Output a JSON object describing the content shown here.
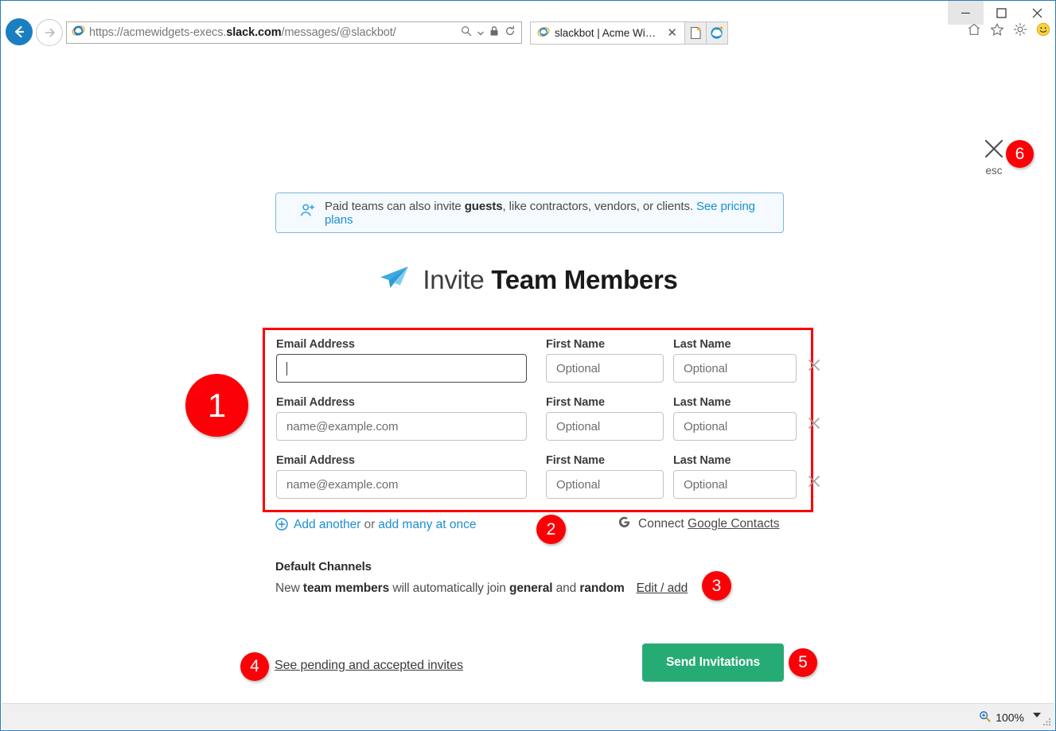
{
  "browser": {
    "back_icon": "back-arrow-icon",
    "forward_icon": "forward-arrow-icon",
    "address_url_prefix": "https://acmewidgets-execs.",
    "address_url_domain": "slack.com",
    "address_url_suffix": "/messages/@slackbot/",
    "address_full": "https://acmewidgets-execs.slack.com/messages/@slackbot/",
    "search_icon": "search-icon",
    "lock_icon": "lock-icon",
    "refresh_icon": "refresh-icon",
    "tab_title": "slackbot | Acme Widgets Sl...",
    "tab_close_label": "✕",
    "new_tab_label": "new-tab",
    "new_edge_tab_label": "new-edge-tab",
    "minimize_label": "─",
    "maximize_label": "☐",
    "close_label": "✕",
    "home_icon": "home-icon",
    "favorites_icon": "star-icon",
    "settings_icon": "gear-icon",
    "smiley_icon": "smiley-face-icon"
  },
  "page": {
    "close": {
      "x_label": "✕",
      "esc_label": "esc"
    },
    "guest_banner": {
      "icon": "add-person-icon",
      "text_before": "Paid teams can also invite ",
      "bold": "guests",
      "text_after": ", like contractors, vendors, or clients. ",
      "link": "See pricing plans"
    },
    "title": {
      "icon": "paper-plane-icon",
      "light": "Invite ",
      "bold": "Team Members"
    },
    "form": {
      "labels": {
        "email": "Email Address",
        "first": "First Name",
        "last": "Last Name"
      },
      "remove_icon_label": "✕",
      "rows": [
        {
          "email_value": "",
          "email_placeholder": "",
          "email_focused": true,
          "first_placeholder": "Optional",
          "last_placeholder": "Optional"
        },
        {
          "email_value": "",
          "email_placeholder": "name@example.com",
          "email_focused": false,
          "first_placeholder": "Optional",
          "last_placeholder": "Optional"
        },
        {
          "email_value": "",
          "email_placeholder": "name@example.com",
          "email_focused": false,
          "first_placeholder": "Optional",
          "last_placeholder": "Optional"
        }
      ]
    },
    "add_row": {
      "plus_icon": "plus-circle-icon",
      "add_another": "Add another",
      "or": "or",
      "add_many": "add many at once",
      "google_icon": "google-g-icon",
      "connect_prefix": "Connect ",
      "connect_link": "Google Contacts"
    },
    "default_channels": {
      "title": "Default Channels",
      "desc_1": "New ",
      "desc_bold_1": "team members",
      "desc_2": " will automatically join ",
      "desc_bold_2": "general",
      "desc_3": " and ",
      "desc_bold_3": "random",
      "edit_link": "Edit / add"
    },
    "footer": {
      "pending_link": "See pending and accepted invites",
      "send_button": "Send Invitations",
      "send_button_color": "#27ab74"
    }
  },
  "annotations": {
    "color": "#fb0006",
    "badges": [
      {
        "id": "1",
        "label": "1"
      },
      {
        "id": "2",
        "label": "2"
      },
      {
        "id": "3",
        "label": "3"
      },
      {
        "id": "4",
        "label": "4"
      },
      {
        "id": "5",
        "label": "5"
      },
      {
        "id": "6",
        "label": "6"
      }
    ],
    "highlight_region": "invite-rows"
  },
  "statusbar": {
    "zoom_icon": "zoom-magnifier-icon",
    "zoom_level": "100%",
    "zoom_caret": "chevron-down-icon",
    "resize_grip": "resize-grip-icon"
  }
}
